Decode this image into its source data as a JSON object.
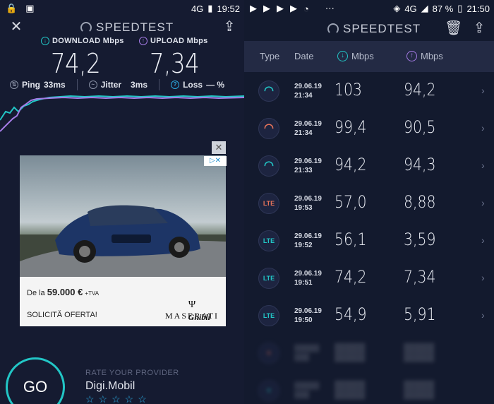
{
  "left": {
    "status": {
      "network": "4G",
      "time": "19:52"
    },
    "brand": "SPEEDTEST",
    "download_label": "DOWNLOAD Mbps",
    "upload_label": "UPLOAD Mbps",
    "download_value": "74,2",
    "upload_value": "7,34",
    "ping_label": "Ping",
    "ping_value": "33ms",
    "jitter_label": "Jitter",
    "jitter_value": "3ms",
    "loss_label": "Loss",
    "loss_value": "— %",
    "ad": {
      "price_prefix": "De la",
      "price": "59.000 €",
      "price_suffix": "+TVA",
      "cta": "SOLICITĂ OFERTA!",
      "brand": "MASERATI",
      "model": "Ghibli"
    },
    "go_label": "GO",
    "rate_label": "RATE YOUR PROVIDER",
    "provider": "Digi.Mobil",
    "stars": "☆☆☆☆☆"
  },
  "right": {
    "status": {
      "network": "4G",
      "battery": "87 %",
      "time": "21:50"
    },
    "brand": "SPEEDTEST",
    "columns": {
      "type": "Type",
      "date": "Date",
      "download": "Mbps",
      "upload": "Mbps"
    },
    "rows": [
      {
        "type": "wifi",
        "type_color": "#22c6c6",
        "date": "29.06.19",
        "time": "21:34",
        "download": "103",
        "upload": "94,2"
      },
      {
        "type": "wifi",
        "type_color": "#e8745a",
        "date": "29.06.19",
        "time": "21:34",
        "download": "99,4",
        "upload": "90,5"
      },
      {
        "type": "wifi",
        "type_color": "#22c6c6",
        "date": "29.06.19",
        "time": "21:33",
        "download": "94,2",
        "upload": "94,3"
      },
      {
        "type": "LTE",
        "type_color": "#e8745a",
        "date": "29.06.19",
        "time": "19:53",
        "download": "57,0",
        "upload": "8,88"
      },
      {
        "type": "LTE",
        "type_color": "#22c6c6",
        "date": "29.06.19",
        "time": "19:52",
        "download": "56,1",
        "upload": "3,59"
      },
      {
        "type": "LTE",
        "type_color": "#22c6c6",
        "date": "29.06.19",
        "time": "19:51",
        "download": "74,2",
        "upload": "7,34"
      },
      {
        "type": "LTE",
        "type_color": "#22c6c6",
        "date": "29.06.19",
        "time": "19:50",
        "download": "54,9",
        "upload": "5,91"
      }
    ]
  },
  "colors": {
    "download": "#22c6c6",
    "upload": "#a57be6",
    "accent": "#22c6c6",
    "orange": "#e8745a"
  }
}
